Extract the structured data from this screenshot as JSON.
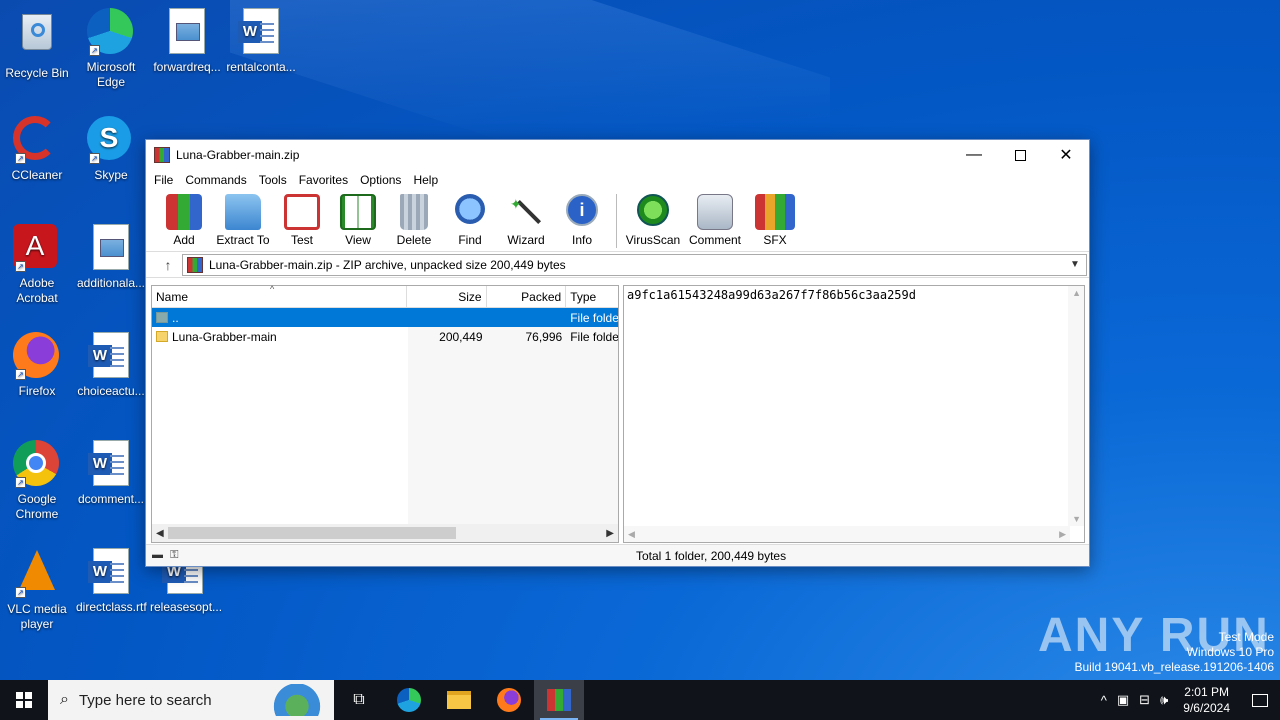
{
  "desktop": {
    "icons": [
      {
        "label": "Recycle Bin",
        "icon": "recycle-bin-icon"
      },
      {
        "label": "Microsoft Edge",
        "icon": "edge-icon"
      },
      {
        "label": "forwardreq...",
        "icon": "image-file-icon"
      },
      {
        "label": "rentalconta...",
        "icon": "word-doc-icon"
      },
      {
        "label": "CCleaner",
        "icon": "ccleaner-icon"
      },
      {
        "label": "Skype",
        "icon": "skype-icon"
      },
      {
        "label": "Adobe Acrobat",
        "icon": "acrobat-icon"
      },
      {
        "label": "additionala...",
        "icon": "image-file-icon"
      },
      {
        "label": "Firefox",
        "icon": "firefox-icon"
      },
      {
        "label": "choiceactu...",
        "icon": "word-doc-icon"
      },
      {
        "label": "Google Chrome",
        "icon": "chrome-icon"
      },
      {
        "label": "dcomment...",
        "icon": "word-doc-icon"
      },
      {
        "label": "VLC media player",
        "icon": "vlc-icon"
      },
      {
        "label": "directclass.rtf",
        "icon": "word-doc-icon"
      },
      {
        "label": "releasesopt...",
        "icon": "word-doc-icon"
      }
    ]
  },
  "window": {
    "title": "Luna-Grabber-main.zip",
    "menu": [
      "File",
      "Commands",
      "Tools",
      "Favorites",
      "Options",
      "Help"
    ],
    "toolbar": [
      "Add",
      "Extract To",
      "Test",
      "View",
      "Delete",
      "Find",
      "Wizard",
      "Info",
      "VirusScan",
      "Comment",
      "SFX"
    ],
    "address": "Luna-Grabber-main.zip - ZIP archive, unpacked size 200,449 bytes",
    "columns": {
      "name": "Name",
      "size": "Size",
      "packed": "Packed",
      "type": "Type"
    },
    "rows": [
      {
        "name": "..",
        "size": "",
        "packed": "",
        "type": "File folder"
      },
      {
        "name": "Luna-Grabber-main",
        "size": "200,449",
        "packed": "76,996",
        "type": "File folder"
      }
    ],
    "comment": "a9fc1a61543248a99d63a267f7f86b56c3aa259d",
    "status": "Total 1 folder, 200,449 bytes"
  },
  "taskbar": {
    "search_placeholder": "Type here to search",
    "time": "2:01 PM",
    "date": "9/6/2024"
  },
  "watermark": {
    "brand": "ANY RUN",
    "line1": "Test Mode",
    "line2": "Windows 10 Pro",
    "line3": "Build 19041.vb_release.191206-1406"
  }
}
